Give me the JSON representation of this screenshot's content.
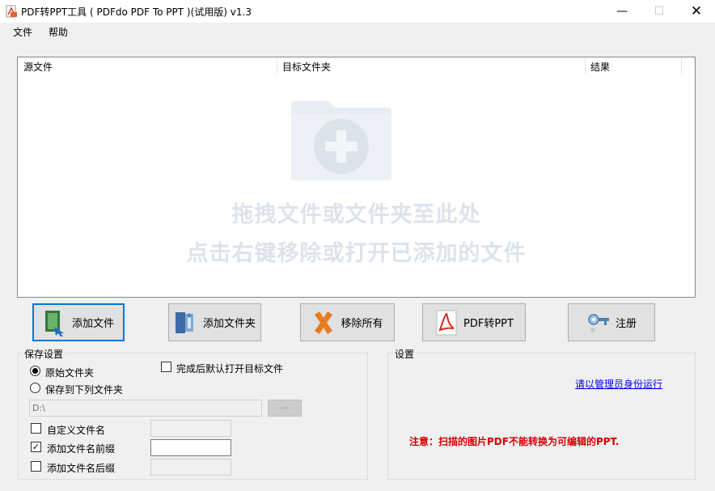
{
  "window": {
    "title": "PDF转PPT工具 ( PDFdo PDF To PPT )(试用版) v1.3",
    "minimize": "—",
    "maximize": "☐",
    "close": "✕"
  },
  "menu": {
    "file": "文件",
    "help": "帮助"
  },
  "list": {
    "col_source": "源文件",
    "col_target": "目标文件夹",
    "col_result": "结果",
    "drop_hint_1": "拖拽文件或文件夹至此处",
    "drop_hint_2": "点击右键移除或打开已添加的文件"
  },
  "buttons": {
    "add_file": "添加文件",
    "add_folder": "添加文件夹",
    "remove_all": "移除所有",
    "convert": "PDF转PPT",
    "register": "注册"
  },
  "save_settings": {
    "title": "保存设置",
    "original_folder": "原始文件夹",
    "save_to_folder": "保存到下列文件夹",
    "open_after": "完成后默认打开目标文件",
    "folder_path": "D:\\",
    "browse": "...",
    "custom_name": "自定义文件名",
    "add_prefix": "添加文件名前缀",
    "add_suffix": "添加文件名后缀",
    "check_mark": "✓",
    "original_selected": true,
    "prefix_checked": true
  },
  "settings": {
    "title": "设置",
    "admin_link": "请以管理员身份运行",
    "notice": "注意：扫描的图片PDF不能转换为可编辑的PPT."
  },
  "colors": {
    "accent": "#0078d7",
    "link": "#0000ee",
    "notice": "#d10000",
    "watermark": "#dde3ea"
  }
}
